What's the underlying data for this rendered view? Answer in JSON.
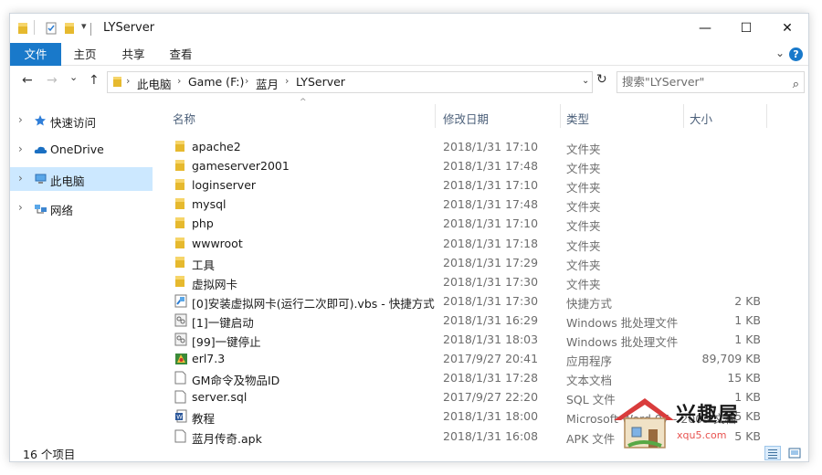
{
  "window": {
    "title": "LYServer",
    "controls": {
      "minimize": "—",
      "maximize": "☐",
      "close": "✕"
    }
  },
  "ribbon": {
    "tabs": [
      {
        "label": "文件",
        "active": true
      },
      {
        "label": "主页",
        "active": false
      },
      {
        "label": "共享",
        "active": false
      },
      {
        "label": "查看",
        "active": false
      }
    ],
    "expand_icon": "chevron-down-icon",
    "help_label": "?"
  },
  "navigation": {
    "back_icon": "←",
    "forward_icon": "→",
    "recent_icon": "⌄",
    "up_icon": "↑",
    "breadcrumb": [
      "此电脑",
      "Game (F:)",
      "蓝月",
      "LYServer"
    ],
    "refresh_icon": "↻",
    "search_placeholder": "搜索\"LYServer\""
  },
  "nav_pane": {
    "items": [
      {
        "label": "快速访问",
        "icon": "star-icon",
        "selected": false
      },
      {
        "label": "OneDrive",
        "icon": "cloud-icon",
        "selected": false
      },
      {
        "label": "此电脑",
        "icon": "computer-icon",
        "selected": true
      },
      {
        "label": "网络",
        "icon": "network-icon",
        "selected": false
      }
    ]
  },
  "columns": {
    "name": "名称",
    "date": "修改日期",
    "type": "类型",
    "size": "大小"
  },
  "files": [
    {
      "name": "apache2",
      "date": "2018/1/31 17:10",
      "type": "文件夹",
      "size": "",
      "icon": "folder-icon"
    },
    {
      "name": "gameserver2001",
      "date": "2018/1/31 17:48",
      "type": "文件夹",
      "size": "",
      "icon": "folder-icon"
    },
    {
      "name": "loginserver",
      "date": "2018/1/31 17:10",
      "type": "文件夹",
      "size": "",
      "icon": "folder-icon"
    },
    {
      "name": "mysql",
      "date": "2018/1/31 17:48",
      "type": "文件夹",
      "size": "",
      "icon": "folder-icon"
    },
    {
      "name": "php",
      "date": "2018/1/31 17:10",
      "type": "文件夹",
      "size": "",
      "icon": "folder-icon"
    },
    {
      "name": "wwwroot",
      "date": "2018/1/31 17:18",
      "type": "文件夹",
      "size": "",
      "icon": "folder-icon"
    },
    {
      "name": "工具",
      "date": "2018/1/31 17:29",
      "type": "文件夹",
      "size": "",
      "icon": "folder-icon"
    },
    {
      "name": "虚拟网卡",
      "date": "2018/1/31 17:30",
      "type": "文件夹",
      "size": "",
      "icon": "folder-icon"
    },
    {
      "name": "[0]安装虚拟网卡(运行二次即可).vbs - 快捷方式",
      "date": "2018/1/31 17:30",
      "type": "快捷方式",
      "size": "2 KB",
      "icon": "shortcut-icon"
    },
    {
      "name": "[1]一键启动",
      "date": "2018/1/31 16:29",
      "type": "Windows 批处理文件",
      "size": "1 KB",
      "icon": "batch-file-icon"
    },
    {
      "name": "[99]一键停止",
      "date": "2018/1/31 18:03",
      "type": "Windows 批处理文件",
      "size": "1 KB",
      "icon": "batch-file-icon"
    },
    {
      "name": "erl7.3",
      "date": "2017/9/27 20:41",
      "type": "应用程序",
      "size": "89,709 KB",
      "icon": "application-icon"
    },
    {
      "name": "GM命令及物品ID",
      "date": "2018/1/31 17:28",
      "type": "文本文档",
      "size": "15 KB",
      "icon": "text-file-icon"
    },
    {
      "name": "server.sql",
      "date": "2017/9/27 22:20",
      "type": "SQL 文件",
      "size": "1 KB",
      "icon": "file-icon"
    },
    {
      "name": "教程",
      "date": "2018/1/31 18:00",
      "type": "Microsoft Word 97 - 2003 文档",
      "size": "15 KB",
      "icon": "word-document-icon"
    },
    {
      "name": "蓝月传奇.apk",
      "date": "2018/1/31 16:08",
      "type": "APK 文件",
      "size": "5 KB",
      "icon": "file-icon"
    }
  ],
  "status": {
    "item_count": "16 个项目"
  },
  "watermark": {
    "brand": "兴趣屋",
    "domain": "xqu5.com"
  },
  "colors": {
    "accent": "#1979ca",
    "selected_bg": "#cce8ff",
    "folder": "#f2c640",
    "header_text": "#4c607a",
    "watermark_red": "#e8524f"
  }
}
